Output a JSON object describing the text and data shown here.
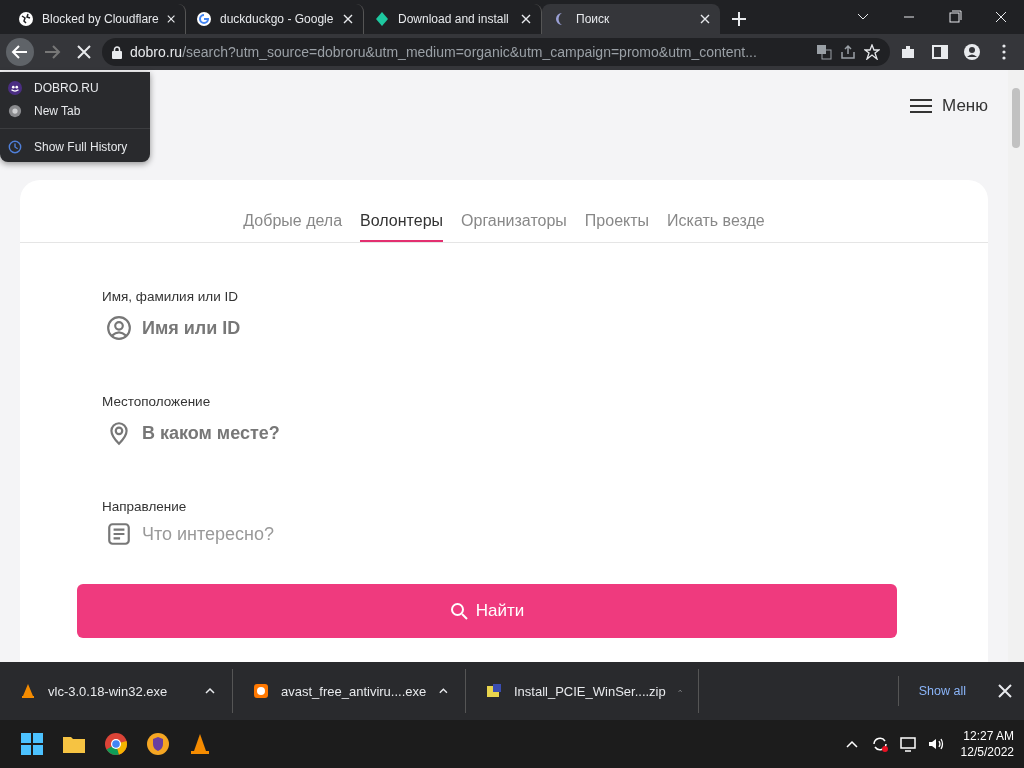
{
  "browser_tabs": [
    {
      "title": "Blocked by Cloudflare",
      "selected": false
    },
    {
      "title": "duckduckgo - Google",
      "selected": false
    },
    {
      "title": "Download and install",
      "selected": false
    },
    {
      "title": "Поиск",
      "selected": true
    }
  ],
  "address": {
    "host": "dobro.ru",
    "path": "/search?utm_source=dobroru&utm_medium=organic&utm_campaign=promo&utm_content..."
  },
  "history_menu": {
    "items": [
      {
        "label": "DOBRO.RU"
      },
      {
        "label": "New Tab"
      }
    ],
    "footer": "Show Full History"
  },
  "page": {
    "menu_label": "Меню",
    "tabs": [
      {
        "label": "Добрые дела",
        "selected": false
      },
      {
        "label": "Волонтеры",
        "selected": true
      },
      {
        "label": "Организаторы",
        "selected": false
      },
      {
        "label": "Проекты",
        "selected": false
      },
      {
        "label": "Искать везде",
        "selected": false
      }
    ],
    "fields": [
      {
        "label": "Имя, фамилия или ID",
        "placeholder": "Имя или ID",
        "kind": "input"
      },
      {
        "label": "Местоположение",
        "placeholder": "В каком месте?",
        "kind": "input"
      },
      {
        "label": "Направление",
        "placeholder": "Что интересно?",
        "kind": "select"
      }
    ],
    "search_button": "Найти"
  },
  "downloads": [
    {
      "name": "vlc-3.0.18-win32.exe"
    },
    {
      "name": "avast_free_antiviru....exe"
    },
    {
      "name": "Install_PCIE_WinSer....zip"
    }
  ],
  "show_all": "Show all",
  "taskbar": {
    "time": "12:27 AM",
    "date": "12/5/2022"
  }
}
